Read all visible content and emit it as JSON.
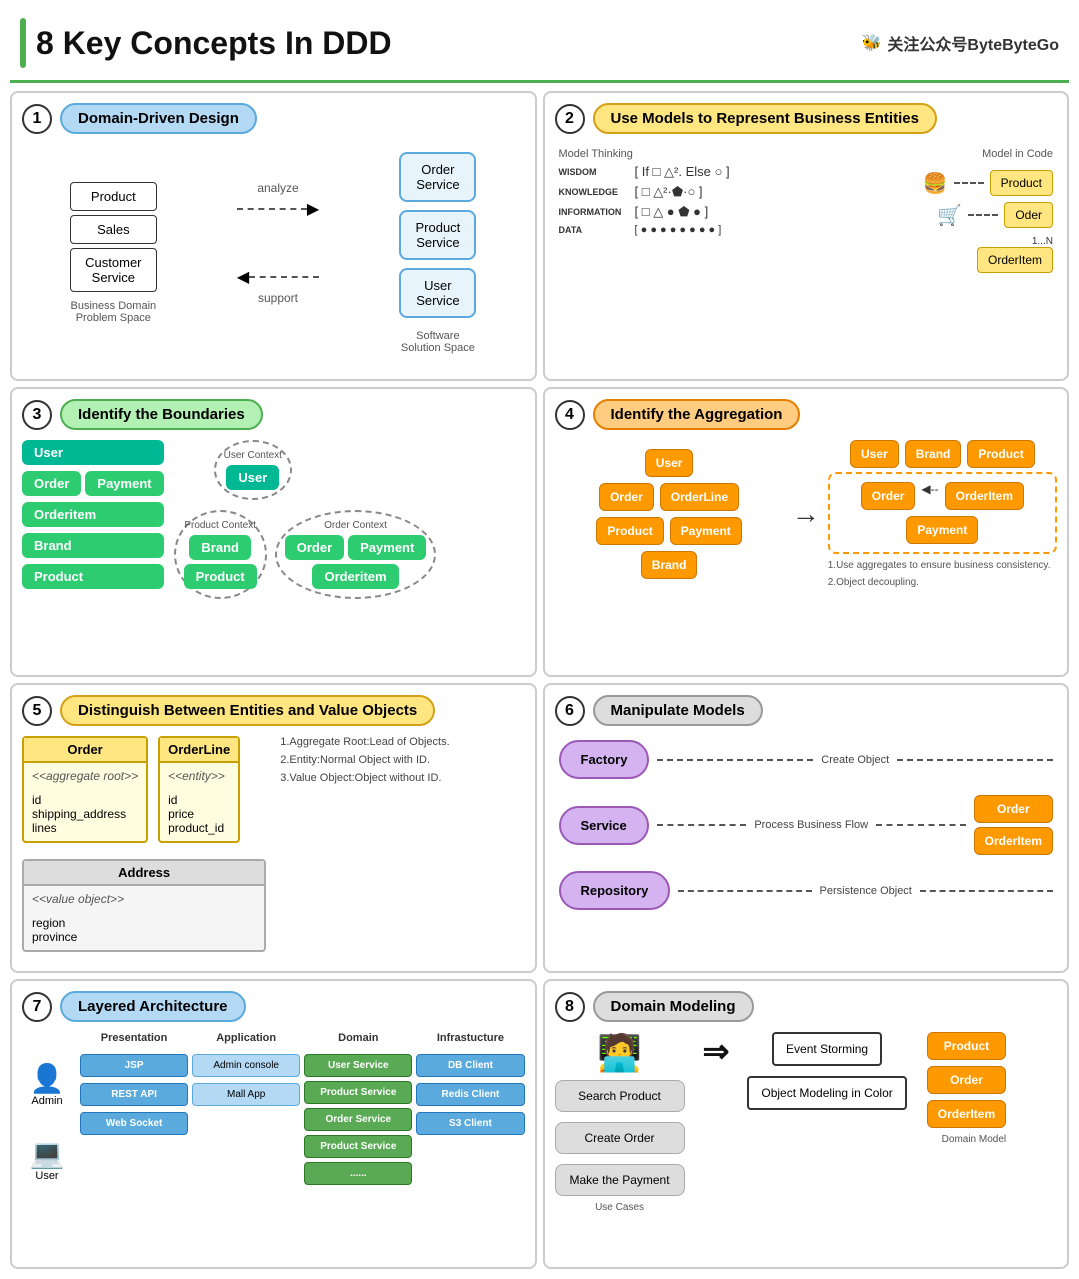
{
  "header": {
    "title": "8 Key Concepts In DDD",
    "brand": "关注公众号ByteByteGo"
  },
  "panel1": {
    "number": "1",
    "title": "Domain-Driven Design",
    "left_items": [
      "Product",
      "Sales",
      "Customer Service"
    ],
    "right_items": [
      "Order Service",
      "Product Service",
      "User Service"
    ],
    "arrow1": "analyze",
    "arrow2": "support",
    "label_left": "Business Domain\nProblem Space",
    "label_right": "Software\nSolution Space"
  },
  "panel2": {
    "number": "2",
    "title": "Use Models to Represent Business Entities",
    "wisdom_rows": [
      {
        "label": "WISDOM",
        "symbols": "[ If □ △². Else ○ ]"
      },
      {
        "label": "KNOWLEDGE",
        "symbols": "[ □· △²·⬟·○ ]"
      },
      {
        "label": "INFORMATION",
        "symbols": "[ □ △ ● ⬟ ● ]"
      },
      {
        "label": "DATA",
        "symbols": "[ ●●●●●●●● ]"
      }
    ],
    "model_label1": "Model Thinking",
    "model_label2": "Model in Code",
    "items": [
      "Product",
      "Oder",
      "OrderItem"
    ]
  },
  "panel3": {
    "number": "3",
    "title": "Identify the Boundaries",
    "entities": [
      "User",
      "Order",
      "Payment",
      "Orderitem",
      "Brand",
      "Product"
    ],
    "contexts": [
      {
        "name": "User Context",
        "items": [
          "User"
        ]
      },
      {
        "name": "Product Context",
        "items": [
          "Brand",
          "Product"
        ]
      },
      {
        "name": "Order Context",
        "items": [
          "Order",
          "Payment",
          "Orderitem"
        ]
      }
    ]
  },
  "panel4": {
    "number": "4",
    "title": "Identify the Aggregation",
    "left_items": [
      "User",
      "Order",
      "OrderLine",
      "Product",
      "Payment",
      "Brand"
    ],
    "right_items": [
      "User",
      "Brand",
      "Product",
      "Order",
      "OrderItem",
      "Payment"
    ],
    "notes": [
      "1.Use aggregates to ensure business consistency.",
      "2.Object decoupling."
    ]
  },
  "panel5": {
    "number": "5",
    "title": "Distinguish Between Entities and Value Objects",
    "order_box": {
      "name": "Order",
      "stereotype": "<<aggregate root>>",
      "fields": [
        "id",
        "shipping_address",
        "lines"
      ]
    },
    "orderline_box": {
      "name": "OrderLine",
      "stereotype": "<<entity>>",
      "fields": [
        "id",
        "price",
        "product_id"
      ]
    },
    "address_box": {
      "name": "Address",
      "stereotype": "<<value object>>",
      "fields": [
        "region",
        "province"
      ]
    },
    "notes": [
      "1.Aggregate Root:Lead of Objects.",
      "2.Entity:Normal Object with ID.",
      "3.Value Object:Object without ID."
    ]
  },
  "panel6": {
    "number": "6",
    "title": "Manipulate Models",
    "rows": [
      {
        "actor": "Factory",
        "label": "Create Object",
        "target": null
      },
      {
        "actor": "Service",
        "label": "Process Business Flow",
        "target": "Order / OrderItem"
      },
      {
        "actor": "Repository",
        "label": "Persistence Object",
        "target": null
      }
    ]
  },
  "panel7": {
    "number": "7",
    "title": "Layered Architecture",
    "layers": [
      "Presentation",
      "Application",
      "Domain",
      "Infrastucture"
    ],
    "actors": [
      "Admin",
      "User"
    ],
    "items": {
      "presentation": [
        "JSP",
        "REST API",
        "Web Socket"
      ],
      "application": [
        "Admin console",
        "Mall App"
      ],
      "domain": [
        "User Service",
        "Product Service",
        "Order Service",
        "Product Service",
        "......"
      ],
      "infrastructure": [
        "DB Client",
        "Redis Client",
        "S3 Client"
      ]
    }
  },
  "panel8": {
    "number": "8",
    "title": "Domain Modeling",
    "use_cases": [
      "Search Product",
      "Create Order",
      "Make the Payment"
    ],
    "actor": "Actor",
    "steps": [
      "Event Storming",
      "Object Modeling in Color"
    ],
    "model_items": [
      "Product",
      "Order",
      "OrderItem"
    ],
    "labels": [
      "Use Cases",
      "Domain Model"
    ]
  }
}
